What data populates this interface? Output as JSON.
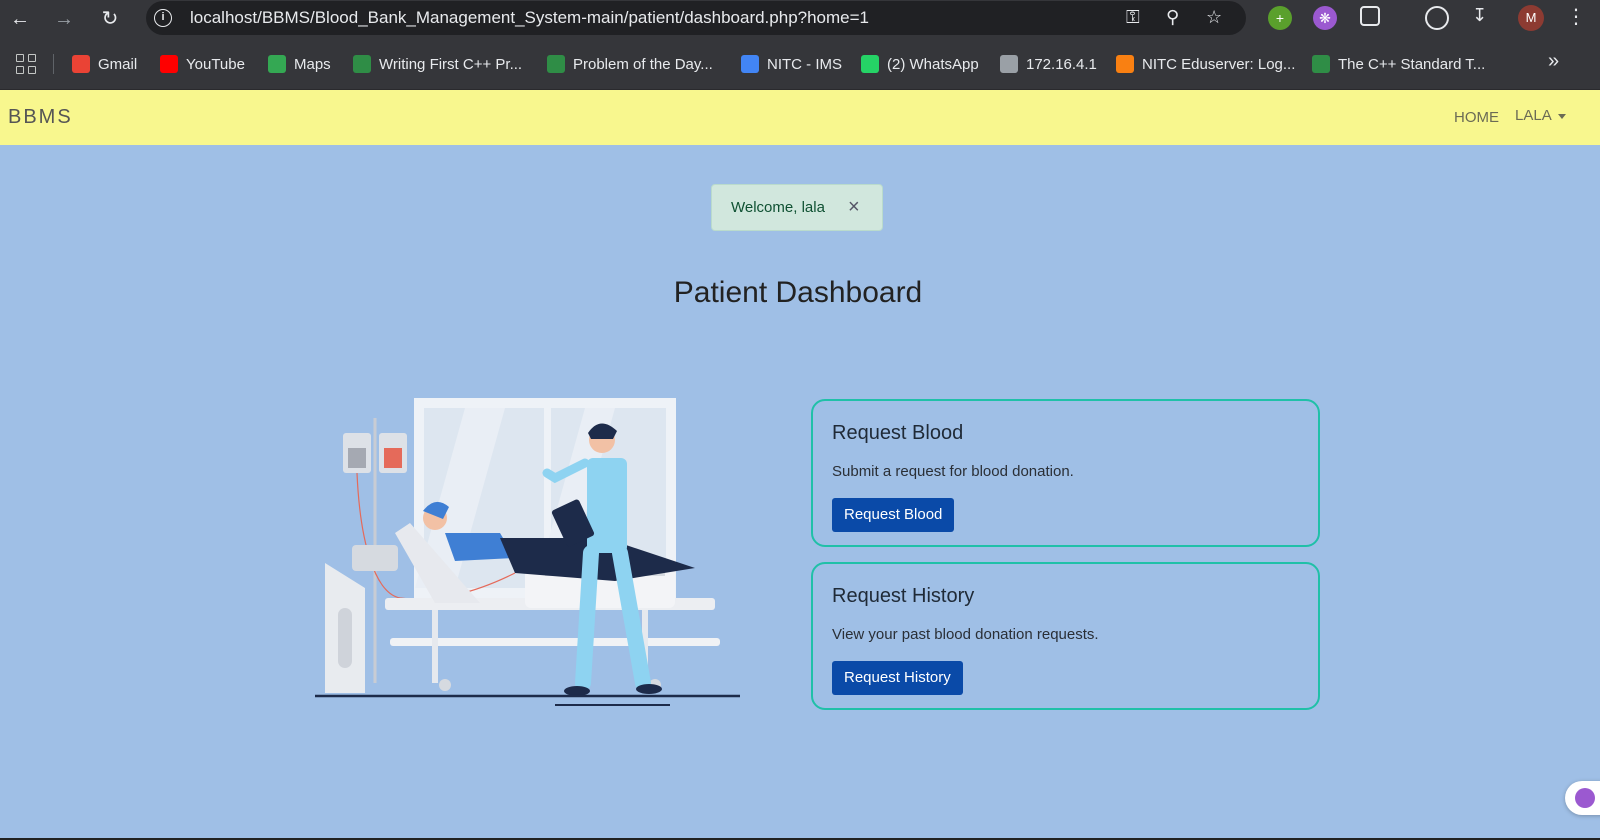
{
  "browser": {
    "url": "localhost/BBMS/Blood_Bank_Management_System-main/patient/dashboard.php?home=1",
    "profile_initial": "M",
    "bookmarks": [
      {
        "label": "Gmail",
        "icon": "gmail-icon",
        "color": "#ea4335"
      },
      {
        "label": "YouTube",
        "icon": "youtube-icon",
        "color": "#ff0000"
      },
      {
        "label": "Maps",
        "icon": "maps-icon",
        "color": "#34a853"
      },
      {
        "label": "Writing First C++ Pr...",
        "icon": "gfg-icon",
        "color": "#2f8d46"
      },
      {
        "label": "Problem of the Day...",
        "icon": "gfg-icon",
        "color": "#2f8d46"
      },
      {
        "label": "NITC - IMS",
        "icon": "google-icon",
        "color": "#4285f4"
      },
      {
        "label": "(2) WhatsApp",
        "icon": "whatsapp-icon",
        "color": "#25d366"
      },
      {
        "label": "172.16.4.1",
        "icon": "globe-icon",
        "color": "#9aa0a6"
      },
      {
        "label": "NITC Eduserver: Log...",
        "icon": "moodle-icon",
        "color": "#f98012"
      },
      {
        "label": "The C++ Standard T...",
        "icon": "gfg-icon",
        "color": "#2f8d46"
      }
    ]
  },
  "navbar": {
    "brand": "BBMS",
    "home_label": "HOME",
    "user_label": "LALA",
    "bg_color": "#f8f78e"
  },
  "alert": {
    "message": "Welcome, lala",
    "close_symbol": "×"
  },
  "page": {
    "title": "Patient Dashboard",
    "bg_color": "#9fbfe6"
  },
  "cards": [
    {
      "title": "Request Blood",
      "text": "Submit a request for blood donation.",
      "button": "Request Blood"
    },
    {
      "title": "Request History",
      "text": "View your past blood donation requests.",
      "button": "Request History"
    }
  ],
  "colors": {
    "accent_button": "#0a4aa8",
    "card_border": "#20c0a8"
  }
}
